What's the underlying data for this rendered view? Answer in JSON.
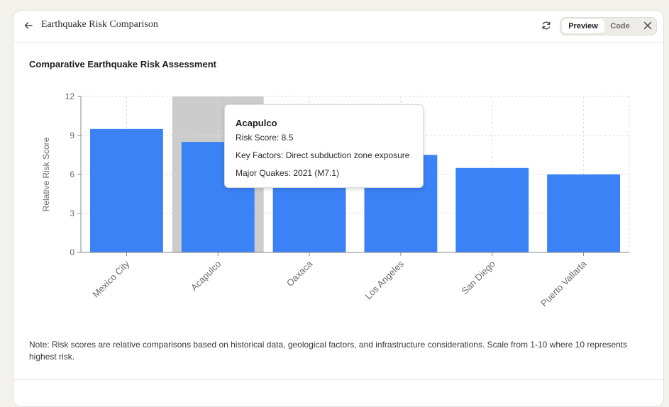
{
  "header": {
    "title": "Earthquake Risk Comparison",
    "tabs": {
      "preview": "Preview",
      "code": "Code"
    },
    "icons": {
      "back": "arrow-left-icon",
      "refresh": "refresh-icon",
      "close": "close-icon"
    }
  },
  "chart_data": {
    "type": "bar",
    "title": "Comparative Earthquake Risk Assessment",
    "ylabel": "Relative Risk Score",
    "xlabel": "",
    "categories": [
      "Mexico City",
      "Acapulco",
      "Oaxaca",
      "Los Angeles",
      "San Diego",
      "Puerto Vallarta"
    ],
    "values": [
      9.5,
      8.5,
      9.0,
      7.5,
      6.5,
      6.0
    ],
    "ylim": [
      0,
      12
    ],
    "yticks": [
      0,
      3,
      6,
      9,
      12
    ],
    "grid": true,
    "bar_color": "#3b82f6",
    "highlight_color": "#cccccc",
    "highlighted_index": 1
  },
  "tooltip": {
    "name": "Acapulco",
    "risk_score": "Risk Score: 8.5",
    "key_factors": "Key Factors: Direct subduction zone exposure",
    "major_quakes": "Major Quakes: 2021 (M7.1)"
  },
  "note": "Note: Risk scores are relative comparisons based on historical data, geological factors, and infrastructure considerations. Scale from 1-10 where 10 represents highest risk."
}
